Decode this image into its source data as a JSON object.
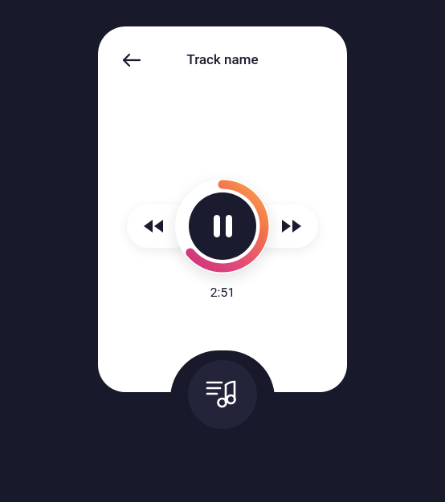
{
  "header": {
    "title": "Track name"
  },
  "player": {
    "elapsed": "2:51",
    "progress": 0.64
  },
  "colors": {
    "dark": "#1a1b2e",
    "bg": "#18192a",
    "grad_a": "#c9307a",
    "grad_b": "#e0497b",
    "grad_c": "#f46f4e",
    "grad_d": "#f9a64a"
  },
  "icons": {
    "back": "back-arrow",
    "prev": "previous-track",
    "next": "next-track",
    "pause": "pause",
    "playlist": "playlist-music"
  }
}
